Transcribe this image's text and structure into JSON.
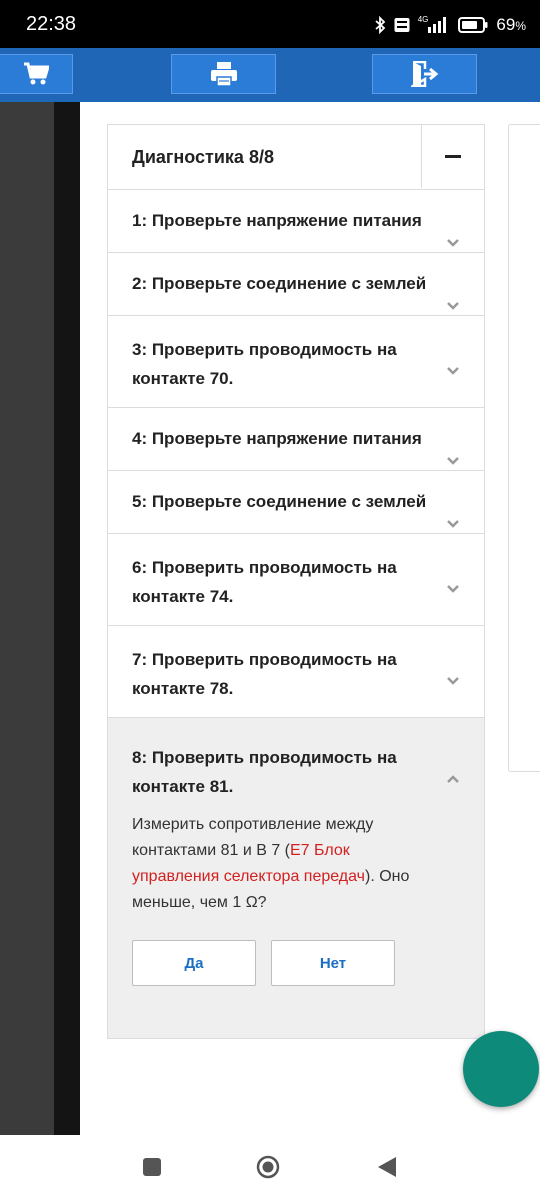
{
  "status_bar": {
    "time": "22:38",
    "battery": "69",
    "battery_suffix": "%",
    "network": "4G",
    "icons": [
      "bluetooth-icon",
      "volte-icon",
      "signal-icon",
      "battery-icon"
    ]
  },
  "toolbar": {
    "buttons": [
      "cart-icon",
      "print-icon",
      "exit-icon"
    ]
  },
  "diagnostics": {
    "title": "Диагностика 8/8",
    "items": [
      {
        "label": "1: Проверьте напряжение питания"
      },
      {
        "label": "2: Проверьте соединение с землей"
      },
      {
        "label": "3: Проверить проводимость на контакте 70."
      },
      {
        "label": "4: Проверьте напряжение питания"
      },
      {
        "label": "5: Проверьте соединение с землей"
      },
      {
        "label": "6: Проверить проводимость на контакте 74."
      },
      {
        "label": "7: Проверить проводимость на контакте 78."
      },
      {
        "label": "8: Проверить проводимость на контакте 81.",
        "desc_before": "Измерить сопротивление между контактами 81 и B 7 (",
        "desc_link": "E7 Блок управления селектора передач",
        "desc_after": "). Оно меньше, чем 1 Ω?",
        "yes_label": "Да",
        "no_label": "Нет"
      }
    ]
  },
  "colors": {
    "toolbar": "#1f66b7",
    "link_red": "#d32020",
    "fab": "#0d8a7a",
    "button_text": "#1a6fc4"
  }
}
